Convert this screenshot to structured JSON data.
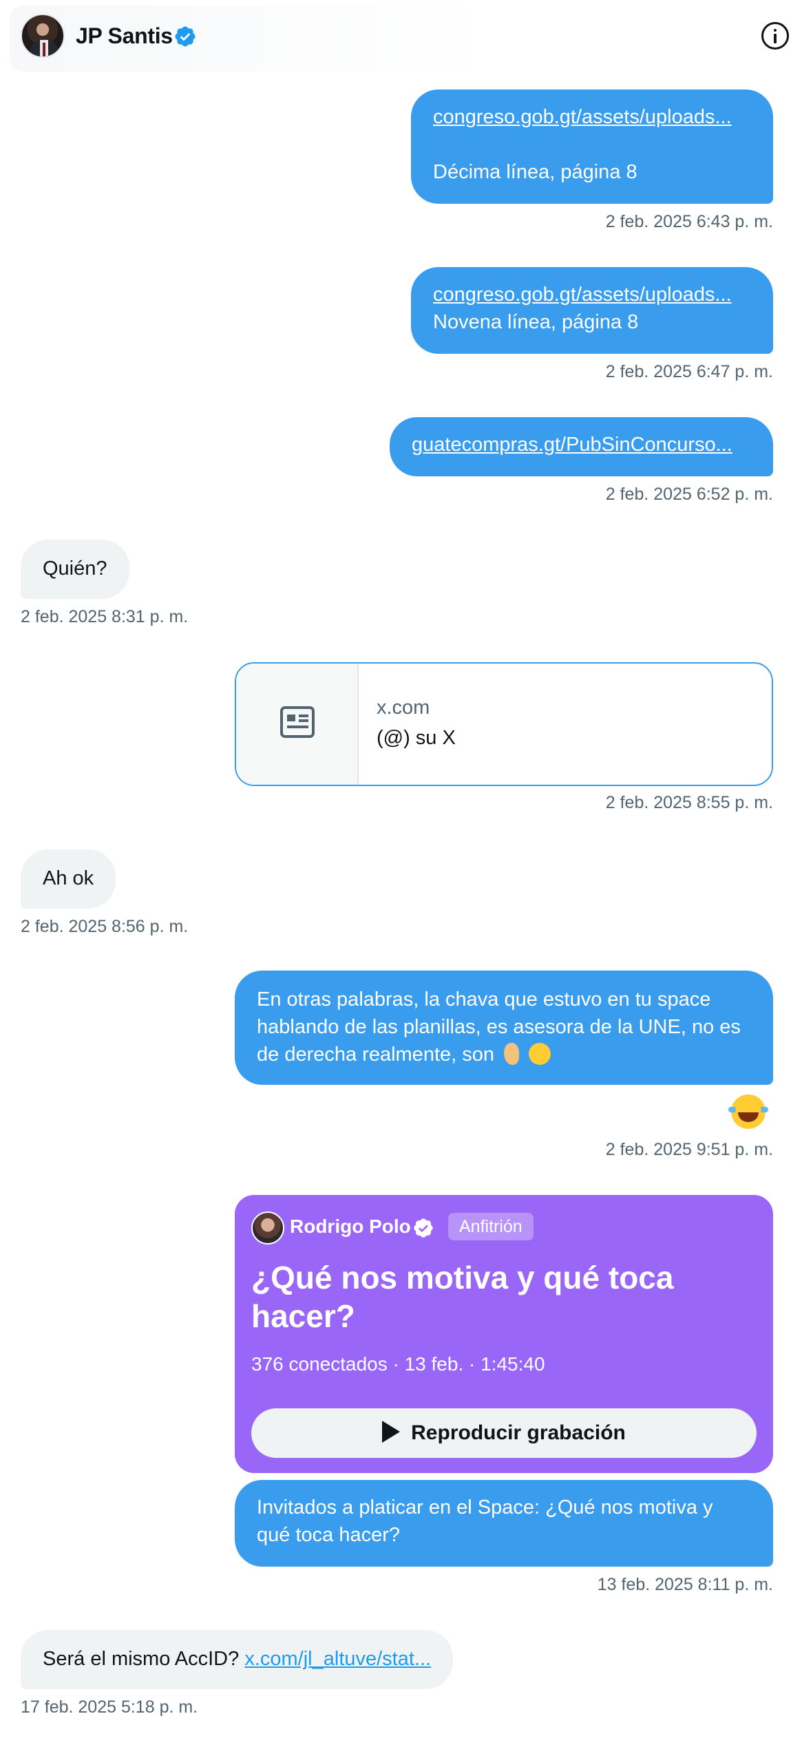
{
  "header": {
    "name": "JP Santis",
    "verified_icon": "verified-badge-icon",
    "info_icon": "info-icon"
  },
  "messages": [
    {
      "dir": "out",
      "link": "congreso.gob.gt/assets/uploads...",
      "text": "Décima línea, página 8",
      "time": "2 feb. 2025 6:43 p. m."
    },
    {
      "dir": "out",
      "link": "congreso.gob.gt/assets/uploads...",
      "text": "Novena línea, página 8",
      "time": "2 feb. 2025 6:47 p. m."
    },
    {
      "dir": "out",
      "link": "guatecompras.gt/PubSinConcurso...",
      "time": "2 feb. 2025 6:52 p. m."
    },
    {
      "dir": "in",
      "text": "Quién?",
      "time": "2 feb. 2025 8:31 p. m."
    },
    {
      "dir": "out",
      "card_domain": "x.com",
      "card_title": "(@) su X",
      "time": "2 feb. 2025 8:55 p. m."
    },
    {
      "dir": "in",
      "text": "Ah ok",
      "time": "2 feb. 2025 8:56 p. m."
    },
    {
      "dir": "out",
      "text": "En otras palabras, la chava que estuvo en tu space hablando de las planillas, es asesora de la UNE, no es de derecha realmente, son",
      "time": "2 feb. 2025 9:51 p. m."
    },
    {
      "dir": "out",
      "space": {
        "host": "Rodrigo Polo",
        "badge": "Anfitrión",
        "title": "¿Qué nos motiva y qué toca hacer?",
        "meta": "376 conectados · 13 feb. · 1:45:40",
        "button": "Reproducir grabación"
      },
      "text": "Invitados a platicar en el Space: ¿Qué nos motiva y qué toca hacer?",
      "time": "13 feb. 2025 8:11 p. m."
    },
    {
      "dir": "in",
      "text": "Será el mismo AccID?",
      "link": "x.com/jl_altuve/stat...",
      "time": "17 feb. 2025 5:18 p. m."
    }
  ]
}
